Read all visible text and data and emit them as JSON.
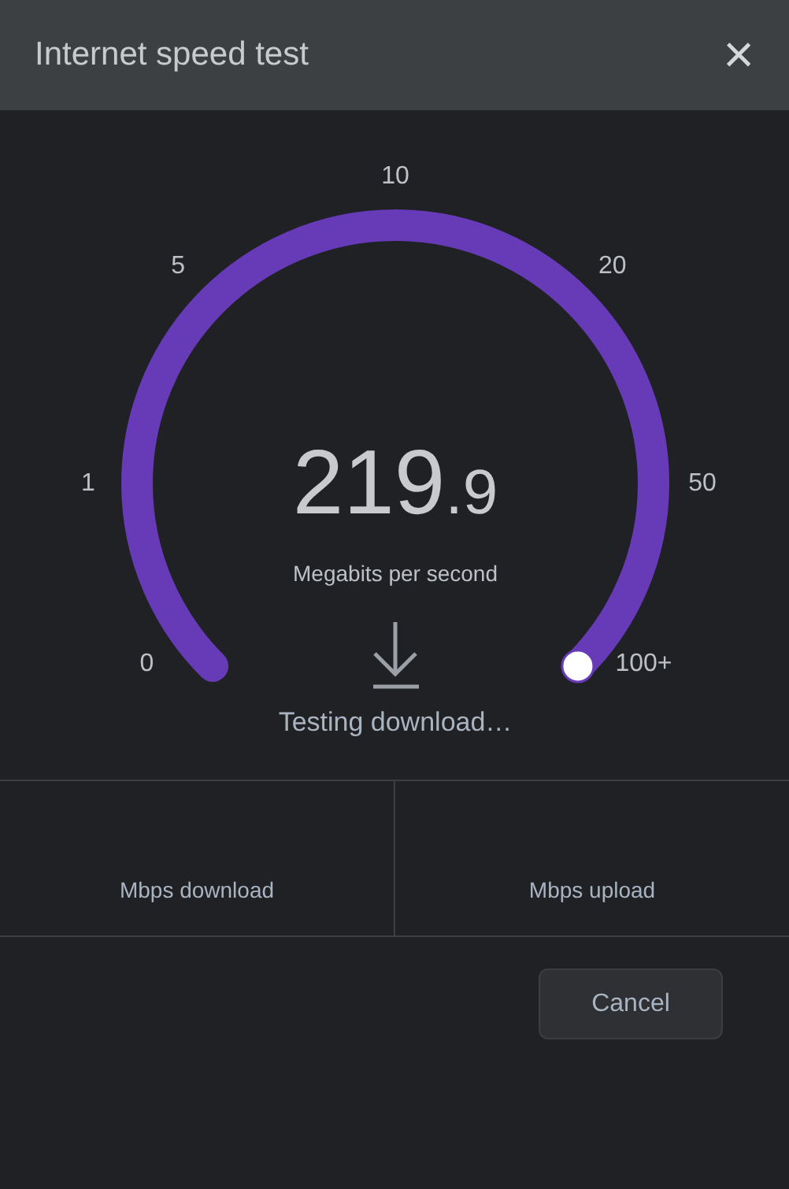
{
  "dialog": {
    "title": "Internet speed test",
    "close": "×"
  },
  "gauge": {
    "ticks": [
      "0",
      "1",
      "5",
      "10",
      "20",
      "50",
      "100+"
    ],
    "reading_whole": "219",
    "reading_fraction": ".9",
    "unit": "Megabits per second",
    "status": "Testing download…"
  },
  "stats": [
    {
      "label": "Mbps download"
    },
    {
      "label": "Mbps upload"
    }
  ],
  "buttons": [
    "Cancel"
  ]
}
